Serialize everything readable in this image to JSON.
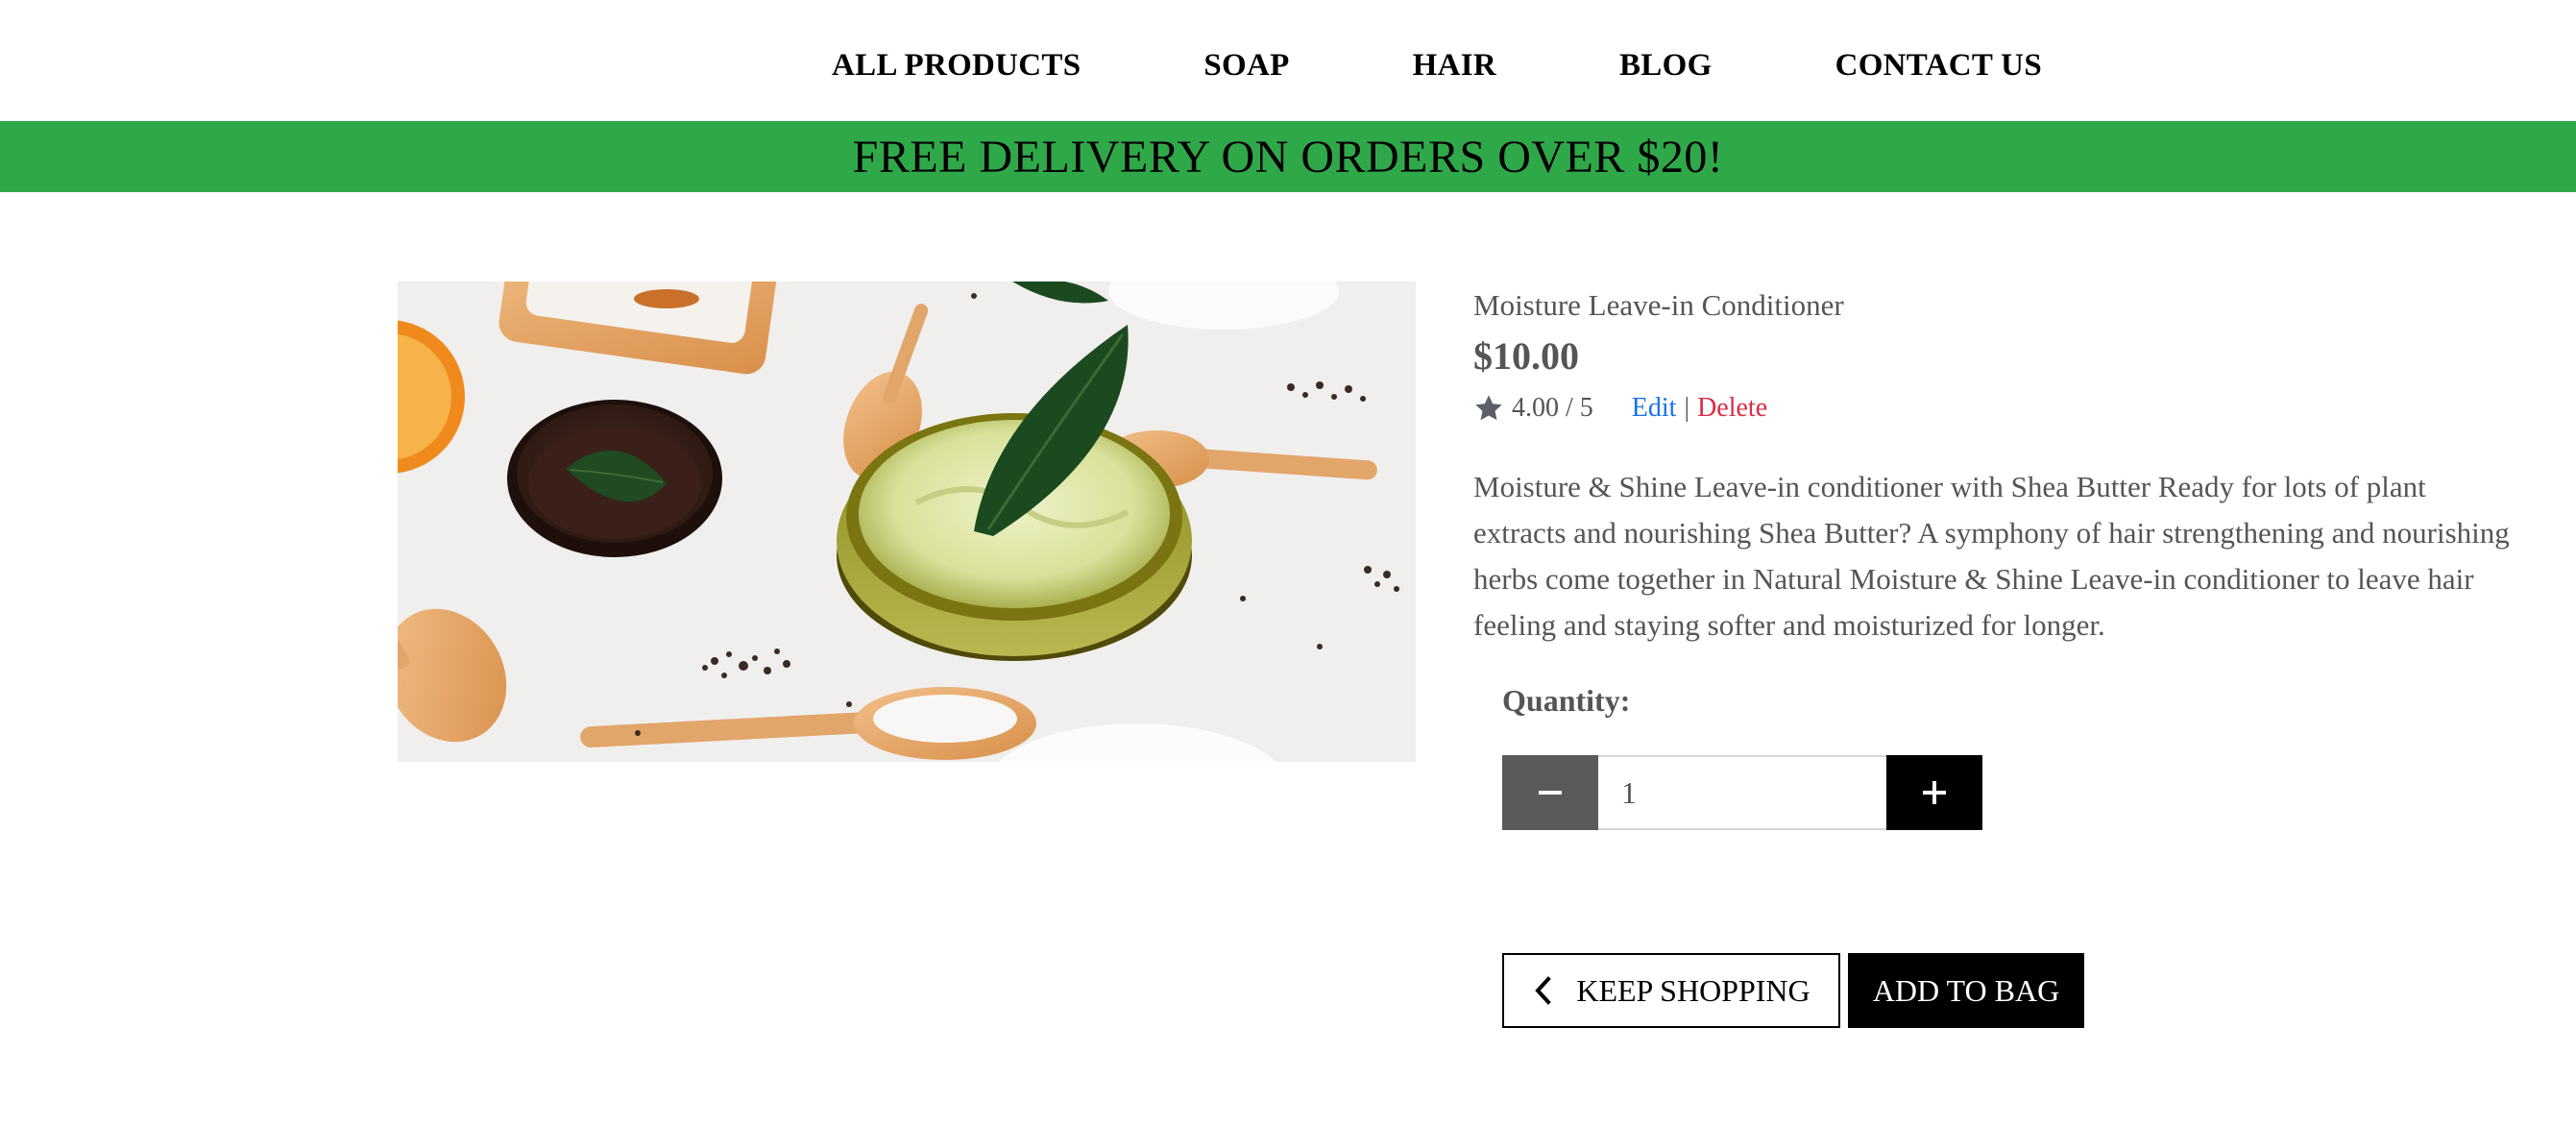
{
  "nav": {
    "items": [
      {
        "label": "ALL PRODUCTS"
      },
      {
        "label": "SOAP"
      },
      {
        "label": "HAIR"
      },
      {
        "label": "BLOG"
      },
      {
        "label": "CONTACT US"
      }
    ]
  },
  "banner": {
    "text": "FREE DELIVERY ON ORDERS OVER $20!",
    "background_color": "#2fa84a"
  },
  "product": {
    "name": "Moisture Leave-in Conditioner",
    "price": "$10.00",
    "rating_icon": "star-icon",
    "rating_text": "4.00 / 5",
    "edit_label": "Edit",
    "separator": "|",
    "delete_label": "Delete",
    "description": "Moisture & Shine Leave-in conditioner with Shea Butter Ready for lots of plant extracts and nourishing Shea Butter? A symphony of hair strengthening and nourishing herbs come together in Natural Moisture & Shine Leave-in conditioner to leave hair feeling and staying softer and moisturized for longer."
  },
  "quantity": {
    "label": "Quantity:",
    "value": "1",
    "minus_icon": "minus-icon",
    "plus_icon": "plus-icon"
  },
  "actions": {
    "keep_shopping_label": "KEEP SHOPPING",
    "keep_shopping_icon": "chevron-left-icon",
    "add_to_bag_label": "ADD TO BAG"
  },
  "colors": {
    "edit_link": "#1a73e8",
    "delete_link": "#dc2b45",
    "text": "#555555"
  }
}
